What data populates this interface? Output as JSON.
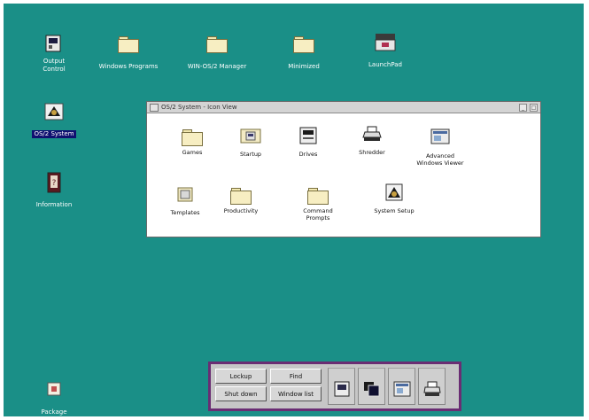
{
  "desktop": {
    "color": "#1a8f87",
    "icons": [
      {
        "label": "Output\nControl",
        "icon": "output-control-icon"
      },
      {
        "label": "Windows Programs",
        "icon": "folder-icon"
      },
      {
        "label": "WIN-OS/2 Manager",
        "icon": "folder-icon"
      },
      {
        "label": "Minimized",
        "icon": "folder-icon"
      },
      {
        "label": "LaunchPad",
        "icon": "launchpad-icon"
      },
      {
        "label": "OS/2 System",
        "icon": "os2-system-icon"
      },
      {
        "label": "Information",
        "icon": "information-icon"
      },
      {
        "label": "Package",
        "icon": "package-icon"
      }
    ]
  },
  "window": {
    "title": "OS/2 System - Icon View",
    "items": [
      {
        "label": "Games",
        "icon": "games-folder-icon"
      },
      {
        "label": "Startup",
        "icon": "startup-folder-icon"
      },
      {
        "label": "Drives",
        "icon": "drives-icon"
      },
      {
        "label": "Shredder",
        "icon": "shredder-icon"
      },
      {
        "label": "Advanced\nWindows Viewer",
        "icon": "viewer-icon"
      },
      {
        "label": "Templates",
        "icon": "templates-icon"
      },
      {
        "label": "Productivity",
        "icon": "productivity-folder-icon"
      },
      {
        "label": "Command Prompts",
        "icon": "command-prompts-folder-icon"
      },
      {
        "label": "System Setup",
        "icon": "system-setup-icon"
      }
    ]
  },
  "launchpad": {
    "buttons": [
      "Lockup",
      "Find",
      "Shut down",
      "Window list"
    ],
    "slots": [
      "drives-icon",
      "window-list-icon",
      "viewer-icon",
      "printer-icon"
    ],
    "border_color": "#6a2d73"
  }
}
